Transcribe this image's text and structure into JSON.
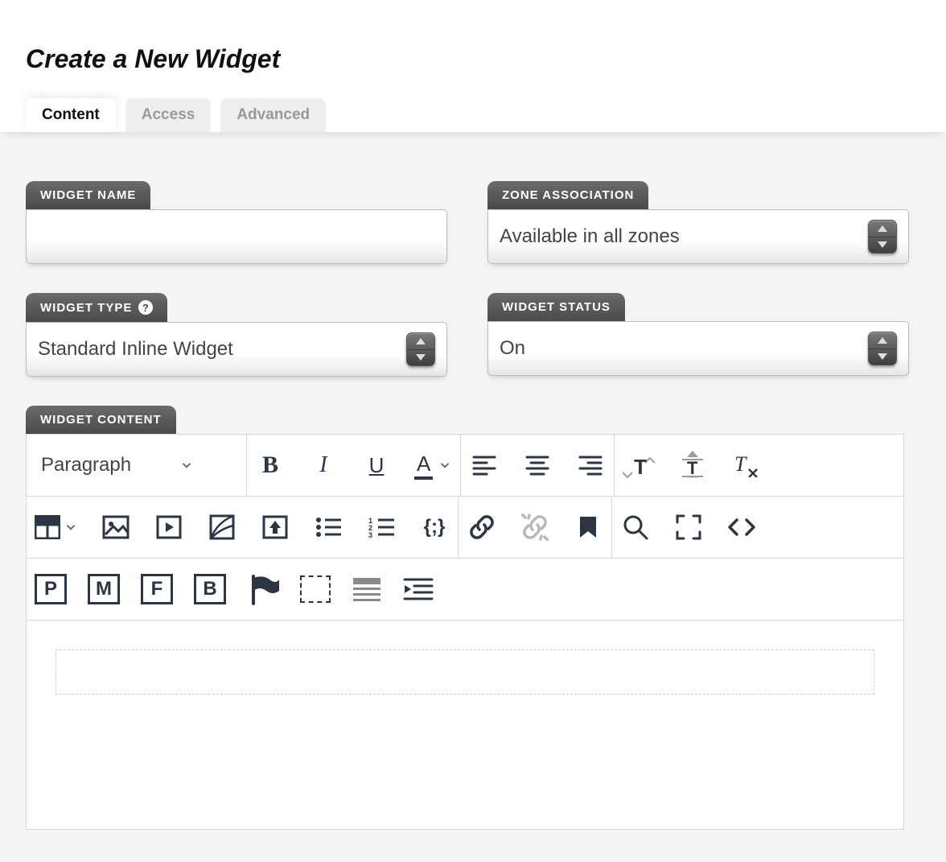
{
  "title": "Create a New Widget",
  "tabs": [
    {
      "label": "Content",
      "active": true
    },
    {
      "label": "Access",
      "active": false
    },
    {
      "label": "Advanced",
      "active": false
    }
  ],
  "fields": {
    "widget_name": {
      "label": "WIDGET NAME",
      "value": ""
    },
    "zone_association": {
      "label": "ZONE ASSOCIATION",
      "value": "Available in all zones"
    },
    "widget_type": {
      "label": "WIDGET TYPE",
      "value": "Standard Inline Widget",
      "help": true
    },
    "widget_status": {
      "label": "WIDGET STATUS",
      "value": "On"
    },
    "widget_content": {
      "label": "WIDGET CONTENT"
    }
  },
  "editor": {
    "format": "Paragraph",
    "content": ""
  }
}
